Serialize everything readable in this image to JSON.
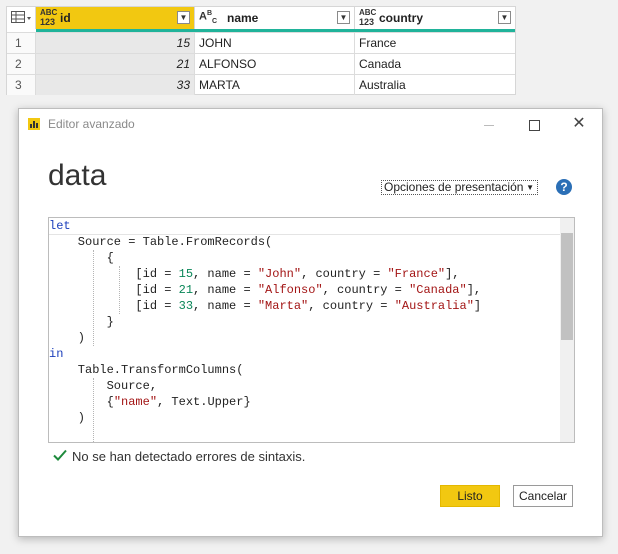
{
  "grid": {
    "columns": [
      {
        "name": "id",
        "type_top": "ABC",
        "type_bottom": "123"
      },
      {
        "name": "name",
        "type": "ABC"
      },
      {
        "name": "country",
        "type_top": "ABC",
        "type_bottom": "123"
      }
    ],
    "rows": [
      {
        "num": "1",
        "id": "15",
        "name": "JOHN",
        "country": "France"
      },
      {
        "num": "2",
        "id": "21",
        "name": "ALFONSO",
        "country": "Canada"
      },
      {
        "num": "3",
        "id": "33",
        "name": "MARTA",
        "country": "Australia"
      }
    ]
  },
  "dialog": {
    "title": "Editor avanzado",
    "query_name": "data",
    "view_options": "Opciones de presentación",
    "help": "?",
    "status": "No se han detectado errores de sintaxis.",
    "done_label": "Listo",
    "cancel_label": "Cancelar"
  },
  "code": {
    "lines": [
      "let",
      "    Source = Table.FromRecords(",
      "        {",
      "            [id = 15, name = \"John\", country = \"France\"],",
      "            [id = 21, name = \"Alfonso\", country = \"Canada\"],",
      "            [id = 33, name = \"Marta\", country = \"Australia\"]",
      "        }",
      "    )",
      "in",
      "    Table.TransformColumns(",
      "        Source,",
      "        {\"name\", Text.Upper}",
      "    )"
    ]
  },
  "colors": {
    "accent": "#f2c811",
    "keyword": "#1c3fbb",
    "number": "#098658",
    "string": "#a31515",
    "quality_bar": "#20b39a"
  }
}
